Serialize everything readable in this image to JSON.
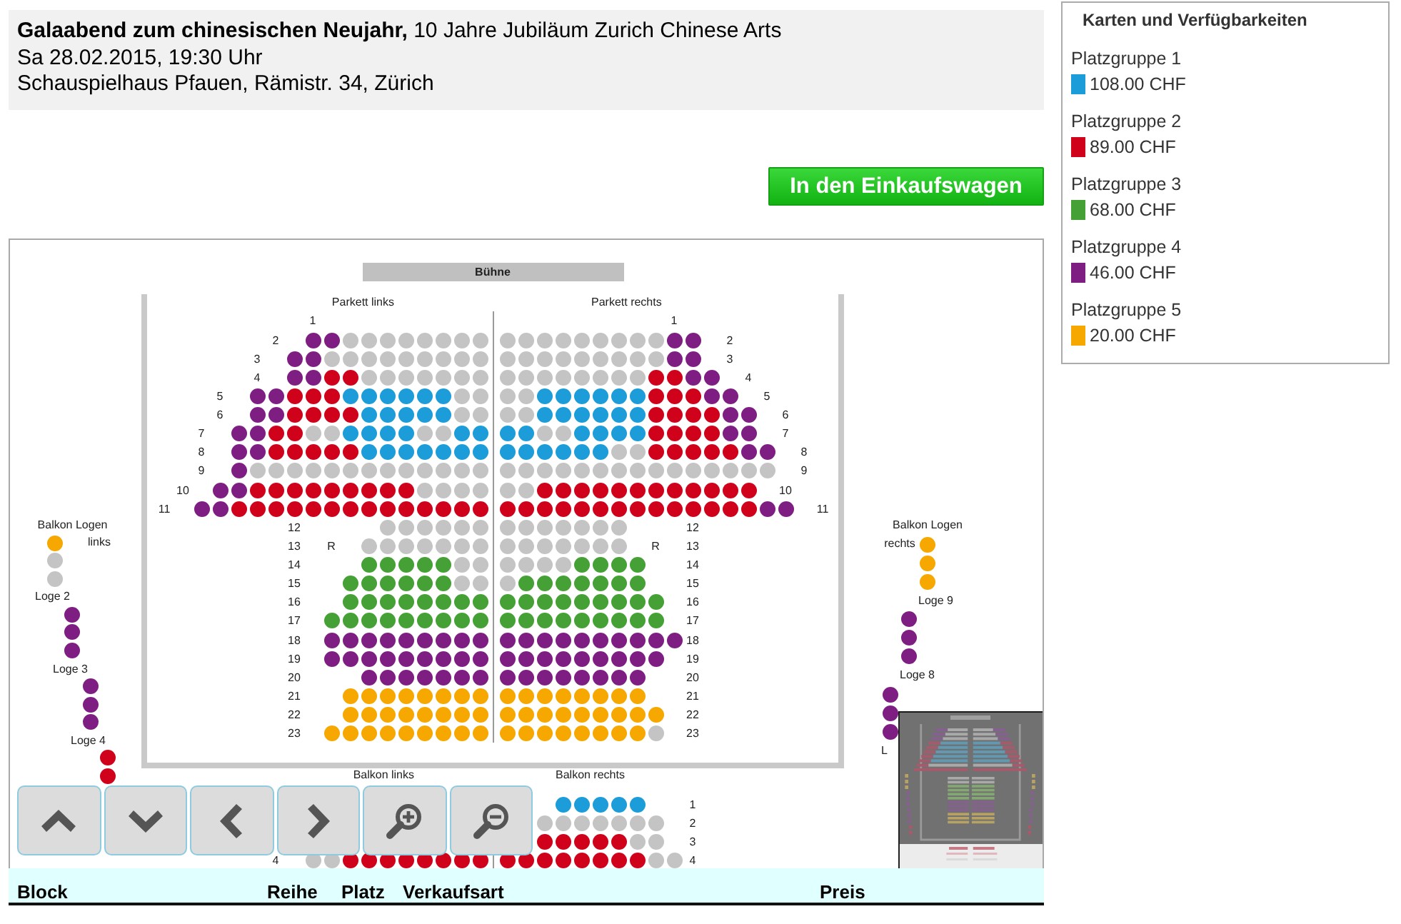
{
  "event": {
    "title": "**Galaabend zum chinesischen Neujahr,** 10 Jahre Jubiläum Zurich Chinese Arts",
    "date": "Sa 28.02.2015, 19:30 Uhr",
    "venue": "Schauspielhaus Pfauen, Rämistr. 34, Zürich"
  },
  "legend": {
    "title": "Karten und Verfügbarkeiten",
    "groups": [
      {
        "label": "Platzgruppe 1",
        "price": "108.00 CHF",
        "color": "#1c9cd8"
      },
      {
        "label": "Platzgruppe 2",
        "price": "89.00 CHF",
        "color": "#d0021b"
      },
      {
        "label": "Platzgruppe 3",
        "price": "68.00 CHF",
        "color": "#45a035"
      },
      {
        "label": "Platzgruppe 4",
        "price": "46.00 CHF",
        "color": "#7e1e82"
      },
      {
        "label": "Platzgruppe 5",
        "price": "20.00 CHF",
        "color": "#f6a800"
      }
    ]
  },
  "cart_button": "In den Einkaufswagen",
  "seat_map": {
    "stage": "Bühne",
    "parkett_links": {
      "title": "Parkett links",
      "front_rows": [
        {
          "label": "1"
        },
        {
          "label": "2",
          "seats": [
            {
              "color": "#7e1e82"
            },
            {
              "color": "#7e1e82"
            },
            {
              "color": "#c4c4c4"
            },
            {
              "color": "#c4c4c4"
            },
            {
              "color": "#c4c4c4"
            },
            {
              "color": "#c4c4c4"
            },
            {
              "color": "#c4c4c4"
            },
            {
              "color": "#c4c4c4"
            },
            {
              "color": "#c4c4c4"
            },
            {
              "color": "#c4c4c4"
            }
          ]
        },
        {
          "label": "3",
          "seats": [
            {
              "color": "#7e1e82"
            },
            {
              "color": "#7e1e82"
            },
            {
              "color": "#c4c4c4"
            },
            {
              "color": "#c4c4c4"
            },
            {
              "color": "#c4c4c4"
            },
            {
              "color": "#c4c4c4"
            },
            {
              "color": "#c4c4c4"
            },
            {
              "color": "#c4c4c4"
            },
            {
              "color": "#c4c4c4"
            },
            {
              "color": "#c4c4c4"
            },
            {
              "color": "#c4c4c4"
            }
          ]
        },
        {
          "label": "4",
          "seats": [
            {
              "color": "#7e1e82"
            },
            {
              "color": "#7e1e82"
            },
            {
              "color": "#d0021b"
            },
            {
              "color": "#d0021b"
            },
            {
              "color": "#c4c4c4"
            },
            {
              "color": "#c4c4c4"
            },
            {
              "color": "#c4c4c4"
            },
            {
              "color": "#c4c4c4"
            },
            {
              "color": "#c4c4c4"
            },
            {
              "color": "#c4c4c4"
            },
            {
              "color": "#c4c4c4"
            }
          ]
        },
        {
          "label": "5",
          "seats": [
            {
              "color": "#7e1e82"
            },
            {
              "color": "#7e1e82"
            },
            {
              "color": "#d0021b"
            },
            {
              "color": "#d0021b"
            },
            {
              "color": "#d0021b"
            },
            {
              "color": "#1c9cd8"
            },
            {
              "color": "#1c9cd8"
            },
            {
              "color": "#1c9cd8"
            },
            {
              "color": "#1c9cd8"
            },
            {
              "color": "#1c9cd8"
            },
            {
              "color": "#1c9cd8"
            },
            {
              "color": "#c4c4c4"
            },
            {
              "color": "#c4c4c4"
            }
          ]
        },
        {
          "label": "6",
          "seats": [
            {
              "color": "#7e1e82"
            },
            {
              "color": "#7e1e82"
            },
            {
              "color": "#d0021b"
            },
            {
              "color": "#d0021b"
            },
            {
              "color": "#d0021b"
            },
            {
              "color": "#d0021b"
            },
            {
              "color": "#1c9cd8"
            },
            {
              "color": "#1c9cd8"
            },
            {
              "color": "#1c9cd8"
            },
            {
              "color": "#1c9cd8"
            },
            {
              "color": "#1c9cd8"
            },
            {
              "color": "#c4c4c4"
            },
            {
              "color": "#c4c4c4"
            }
          ]
        },
        {
          "label": "7",
          "seats": [
            {
              "color": "#7e1e82"
            },
            {
              "color": "#7e1e82"
            },
            {
              "color": "#d0021b"
            },
            {
              "color": "#d0021b"
            },
            {
              "color": "#c4c4c4"
            },
            {
              "color": "#c4c4c4"
            },
            {
              "color": "#1c9cd8"
            },
            {
              "color": "#1c9cd8"
            },
            {
              "color": "#1c9cd8"
            },
            {
              "color": "#1c9cd8"
            },
            {
              "color": "#c4c4c4"
            },
            {
              "color": "#c4c4c4"
            },
            {
              "color": "#1c9cd8"
            },
            {
              "color": "#1c9cd8"
            }
          ]
        },
        {
          "label": "8",
          "seats": [
            {
              "color": "#7e1e82"
            },
            {
              "color": "#7e1e82"
            },
            {
              "color": "#d0021b"
            },
            {
              "color": "#d0021b"
            },
            {
              "color": "#d0021b"
            },
            {
              "color": "#d0021b"
            },
            {
              "color": "#d0021b"
            },
            {
              "color": "#1c9cd8"
            },
            {
              "color": "#1c9cd8"
            },
            {
              "color": "#1c9cd8"
            },
            {
              "color": "#1c9cd8"
            },
            {
              "color": "#1c9cd8"
            },
            {
              "color": "#1c9cd8"
            },
            {
              "color": "#1c9cd8"
            }
          ]
        },
        {
          "label": "9",
          "seats": [
            {
              "color": "#7e1e82"
            },
            {
              "color": "#c4c4c4"
            },
            {
              "color": "#c4c4c4"
            },
            {
              "color": "#c4c4c4"
            },
            {
              "color": "#c4c4c4"
            },
            {
              "color": "#c4c4c4"
            },
            {
              "color": "#c4c4c4"
            },
            {
              "color": "#c4c4c4"
            },
            {
              "color": "#c4c4c4"
            },
            {
              "color": "#c4c4c4"
            },
            {
              "color": "#c4c4c4"
            },
            {
              "color": "#c4c4c4"
            },
            {
              "color": "#c4c4c4"
            },
            {
              "color": "#c4c4c4"
            }
          ]
        },
        {
          "label": "10",
          "seats": [
            {
              "color": "#7e1e82"
            },
            {
              "color": "#7e1e82"
            },
            {
              "color": "#d0021b"
            },
            {
              "color": "#d0021b"
            },
            {
              "color": "#d0021b"
            },
            {
              "color": "#d0021b"
            },
            {
              "color": "#d0021b"
            },
            {
              "color": "#d0021b"
            },
            {
              "color": "#d0021b"
            },
            {
              "color": "#d0021b"
            },
            {
              "color": "#d0021b"
            },
            {
              "color": "#c4c4c4"
            },
            {
              "color": "#c4c4c4"
            },
            {
              "color": "#c4c4c4"
            },
            {
              "color": "#c4c4c4"
            }
          ]
        },
        {
          "label": "11",
          "seats": [
            {
              "color": "#7e1e82"
            },
            {
              "color": "#7e1e82"
            },
            {
              "color": "#d0021b"
            },
            {
              "color": "#d0021b"
            },
            {
              "color": "#d0021b"
            },
            {
              "color": "#d0021b"
            },
            {
              "color": "#d0021b"
            },
            {
              "color": "#d0021b"
            },
            {
              "color": "#d0021b"
            },
            {
              "color": "#d0021b"
            },
            {
              "color": "#d0021b"
            },
            {
              "color": "#d0021b"
            },
            {
              "color": "#d0021b"
            },
            {
              "color": "#d0021b"
            },
            {
              "color": "#d0021b"
            },
            {
              "color": "#d0021b"
            }
          ]
        }
      ],
      "rear_rows": [
        {
          "label": "12",
          "seats": [
            {
              "color": "#c4c4c4"
            },
            {
              "color": "#c4c4c4"
            },
            {
              "color": "#c4c4c4"
            },
            {
              "color": "#c4c4c4"
            },
            {
              "color": "#c4c4c4"
            },
            {
              "color": "#c4c4c4"
            }
          ]
        },
        {
          "label": "13",
          "marker": "R",
          "seats": [
            {
              "color": "#c4c4c4"
            },
            {
              "color": "#c4c4c4"
            },
            {
              "color": "#c4c4c4"
            },
            {
              "color": "#c4c4c4"
            },
            {
              "color": "#c4c4c4"
            },
            {
              "color": "#c4c4c4"
            },
            {
              "color": "#c4c4c4"
            }
          ]
        },
        {
          "label": "14",
          "seats": [
            {
              "color": "#45a035"
            },
            {
              "color": "#45a035"
            },
            {
              "color": "#45a035"
            },
            {
              "color": "#45a035"
            },
            {
              "color": "#45a035"
            },
            {
              "color": "#c4c4c4"
            },
            {
              "color": "#c4c4c4"
            }
          ]
        },
        {
          "label": "15",
          "seats": [
            {
              "color": "#45a035"
            },
            {
              "color": "#45a035"
            },
            {
              "color": "#45a035"
            },
            {
              "color": "#45a035"
            },
            {
              "color": "#45a035"
            },
            {
              "color": "#45a035"
            },
            {
              "color": "#c4c4c4"
            },
            {
              "color": "#c4c4c4"
            }
          ]
        },
        {
          "label": "16",
          "seats": [
            {
              "color": "#45a035"
            },
            {
              "color": "#45a035"
            },
            {
              "color": "#45a035"
            },
            {
              "color": "#45a035"
            },
            {
              "color": "#45a035"
            },
            {
              "color": "#45a035"
            },
            {
              "color": "#45a035"
            },
            {
              "color": "#45a035"
            }
          ]
        },
        {
          "label": "17",
          "seats": [
            {
              "color": "#45a035"
            },
            {
              "color": "#45a035"
            },
            {
              "color": "#45a035"
            },
            {
              "color": "#45a035"
            },
            {
              "color": "#45a035"
            },
            {
              "color": "#45a035"
            },
            {
              "color": "#45a035"
            },
            {
              "color": "#45a035"
            },
            {
              "color": "#45a035"
            }
          ]
        },
        {
          "label": "18",
          "seats": [
            {
              "color": "#7e1e82"
            },
            {
              "color": "#7e1e82"
            },
            {
              "color": "#7e1e82"
            },
            {
              "color": "#7e1e82"
            },
            {
              "color": "#7e1e82"
            },
            {
              "color": "#7e1e82"
            },
            {
              "color": "#7e1e82"
            },
            {
              "color": "#7e1e82"
            },
            {
              "color": "#7e1e82"
            }
          ]
        },
        {
          "label": "19",
          "seats": [
            {
              "color": "#7e1e82"
            },
            {
              "color": "#7e1e82"
            },
            {
              "color": "#7e1e82"
            },
            {
              "color": "#7e1e82"
            },
            {
              "color": "#7e1e82"
            },
            {
              "color": "#7e1e82"
            },
            {
              "color": "#7e1e82"
            },
            {
              "color": "#7e1e82"
            },
            {
              "color": "#7e1e82"
            }
          ]
        },
        {
          "label": "20",
          "seats": [
            {
              "color": "#7e1e82"
            },
            {
              "color": "#7e1e82"
            },
            {
              "color": "#7e1e82"
            },
            {
              "color": "#7e1e82"
            },
            {
              "color": "#7e1e82"
            },
            {
              "color": "#7e1e82"
            },
            {
              "color": "#7e1e82"
            }
          ]
        },
        {
          "label": "21",
          "seats": [
            {
              "color": "#f6a800"
            },
            {
              "color": "#f6a800"
            },
            {
              "color": "#f6a800"
            },
            {
              "color": "#f6a800"
            },
            {
              "color": "#f6a800"
            },
            {
              "color": "#f6a800"
            },
            {
              "color": "#f6a800"
            },
            {
              "color": "#f6a800"
            }
          ]
        },
        {
          "label": "22",
          "seats": [
            {
              "color": "#f6a800"
            },
            {
              "color": "#f6a800"
            },
            {
              "color": "#f6a800"
            },
            {
              "color": "#f6a800"
            },
            {
              "color": "#f6a800"
            },
            {
              "color": "#f6a800"
            },
            {
              "color": "#f6a800"
            },
            {
              "color": "#f6a800"
            }
          ]
        },
        {
          "label": "23",
          "seats": [
            {
              "color": "#f6a800"
            },
            {
              "color": "#f6a800"
            },
            {
              "color": "#f6a800"
            },
            {
              "color": "#f6a800"
            },
            {
              "color": "#f6a800"
            },
            {
              "color": "#f6a800"
            },
            {
              "color": "#f6a800"
            },
            {
              "color": "#f6a800"
            },
            {
              "color": "#f6a800"
            }
          ]
        }
      ]
    },
    "parkett_rechts": {
      "title": "Parkett rechts",
      "front_rows": [
        {
          "label": "1"
        },
        {
          "label": "2",
          "seats": [
            {
              "color": "#c4c4c4"
            },
            {
              "color": "#c4c4c4"
            },
            {
              "color": "#c4c4c4"
            },
            {
              "color": "#c4c4c4"
            },
            {
              "color": "#c4c4c4"
            },
            {
              "color": "#c4c4c4"
            },
            {
              "color": "#c4c4c4"
            },
            {
              "color": "#c4c4c4"
            },
            {
              "color": "#c4c4c4"
            },
            {
              "color": "#7e1e82"
            },
            {
              "color": "#7e1e82"
            }
          ]
        },
        {
          "label": "3",
          "seats": [
            {
              "color": "#c4c4c4"
            },
            {
              "color": "#c4c4c4"
            },
            {
              "color": "#c4c4c4"
            },
            {
              "color": "#c4c4c4"
            },
            {
              "color": "#c4c4c4"
            },
            {
              "color": "#c4c4c4"
            },
            {
              "color": "#c4c4c4"
            },
            {
              "color": "#c4c4c4"
            },
            {
              "color": "#c4c4c4"
            },
            {
              "color": "#7e1e82"
            },
            {
              "color": "#7e1e82"
            }
          ]
        },
        {
          "label": "4",
          "seats": [
            {
              "color": "#c4c4c4"
            },
            {
              "color": "#c4c4c4"
            },
            {
              "color": "#c4c4c4"
            },
            {
              "color": "#c4c4c4"
            },
            {
              "color": "#c4c4c4"
            },
            {
              "color": "#c4c4c4"
            },
            {
              "color": "#c4c4c4"
            },
            {
              "color": "#c4c4c4"
            },
            {
              "color": "#d0021b"
            },
            {
              "color": "#d0021b"
            },
            {
              "color": "#7e1e82"
            },
            {
              "color": "#7e1e82"
            }
          ]
        },
        {
          "label": "5",
          "seats": [
            {
              "color": "#c4c4c4"
            },
            {
              "color": "#c4c4c4"
            },
            {
              "color": "#1c9cd8"
            },
            {
              "color": "#1c9cd8"
            },
            {
              "color": "#1c9cd8"
            },
            {
              "color": "#1c9cd8"
            },
            {
              "color": "#1c9cd8"
            },
            {
              "color": "#1c9cd8"
            },
            {
              "color": "#d0021b"
            },
            {
              "color": "#d0021b"
            },
            {
              "color": "#d0021b"
            },
            {
              "color": "#7e1e82"
            },
            {
              "color": "#7e1e82"
            }
          ]
        },
        {
          "label": "6",
          "seats": [
            {
              "color": "#c4c4c4"
            },
            {
              "color": "#c4c4c4"
            },
            {
              "color": "#1c9cd8"
            },
            {
              "color": "#1c9cd8"
            },
            {
              "color": "#1c9cd8"
            },
            {
              "color": "#1c9cd8"
            },
            {
              "color": "#1c9cd8"
            },
            {
              "color": "#1c9cd8"
            },
            {
              "color": "#d0021b"
            },
            {
              "color": "#d0021b"
            },
            {
              "color": "#d0021b"
            },
            {
              "color": "#d0021b"
            },
            {
              "color": "#7e1e82"
            },
            {
              "color": "#7e1e82"
            }
          ]
        },
        {
          "label": "7",
          "seats": [
            {
              "color": "#1c9cd8"
            },
            {
              "color": "#1c9cd8"
            },
            {
              "color": "#c4c4c4"
            },
            {
              "color": "#c4c4c4"
            },
            {
              "color": "#1c9cd8"
            },
            {
              "color": "#1c9cd8"
            },
            {
              "color": "#1c9cd8"
            },
            {
              "color": "#1c9cd8"
            },
            {
              "color": "#d0021b"
            },
            {
              "color": "#d0021b"
            },
            {
              "color": "#d0021b"
            },
            {
              "color": "#d0021b"
            },
            {
              "color": "#7e1e82"
            },
            {
              "color": "#7e1e82"
            }
          ]
        },
        {
          "label": "8",
          "seats": [
            {
              "color": "#1c9cd8"
            },
            {
              "color": "#1c9cd8"
            },
            {
              "color": "#1c9cd8"
            },
            {
              "color": "#1c9cd8"
            },
            {
              "color": "#1c9cd8"
            },
            {
              "color": "#1c9cd8"
            },
            {
              "color": "#c4c4c4"
            },
            {
              "color": "#c4c4c4"
            },
            {
              "color": "#d0021b"
            },
            {
              "color": "#d0021b"
            },
            {
              "color": "#d0021b"
            },
            {
              "color": "#d0021b"
            },
            {
              "color": "#d0021b"
            },
            {
              "color": "#7e1e82"
            },
            {
              "color": "#7e1e82"
            }
          ]
        },
        {
          "label": "9",
          "seats": [
            {
              "color": "#c4c4c4"
            },
            {
              "color": "#c4c4c4"
            },
            {
              "color": "#c4c4c4"
            },
            {
              "color": "#c4c4c4"
            },
            {
              "color": "#c4c4c4"
            },
            {
              "color": "#c4c4c4"
            },
            {
              "color": "#c4c4c4"
            },
            {
              "color": "#c4c4c4"
            },
            {
              "color": "#c4c4c4"
            },
            {
              "color": "#c4c4c4"
            },
            {
              "color": "#c4c4c4"
            },
            {
              "color": "#c4c4c4"
            },
            {
              "color": "#c4c4c4"
            },
            {
              "color": "#c4c4c4"
            },
            {
              "color": "#c4c4c4"
            }
          ]
        },
        {
          "label": "10",
          "seats": [
            {
              "color": "#c4c4c4"
            },
            {
              "color": "#c4c4c4"
            },
            {
              "color": "#d0021b"
            },
            {
              "color": "#d0021b"
            },
            {
              "color": "#d0021b"
            },
            {
              "color": "#d0021b"
            },
            {
              "color": "#d0021b"
            },
            {
              "color": "#d0021b"
            },
            {
              "color": "#d0021b"
            },
            {
              "color": "#d0021b"
            },
            {
              "color": "#d0021b"
            },
            {
              "color": "#d0021b"
            },
            {
              "color": "#d0021b"
            },
            {
              "color": "#d0021b"
            }
          ]
        },
        {
          "label": "11",
          "seats": [
            {
              "color": "#d0021b"
            },
            {
              "color": "#d0021b"
            },
            {
              "color": "#d0021b"
            },
            {
              "color": "#d0021b"
            },
            {
              "color": "#d0021b"
            },
            {
              "color": "#d0021b"
            },
            {
              "color": "#d0021b"
            },
            {
              "color": "#d0021b"
            },
            {
              "color": "#d0021b"
            },
            {
              "color": "#d0021b"
            },
            {
              "color": "#d0021b"
            },
            {
              "color": "#d0021b"
            },
            {
              "color": "#d0021b"
            },
            {
              "color": "#d0021b"
            },
            {
              "color": "#7e1e82"
            },
            {
              "color": "#7e1e82"
            }
          ]
        }
      ],
      "rear_rows": [
        {
          "label": "12",
          "seats": [
            {
              "color": "#c4c4c4"
            },
            {
              "color": "#c4c4c4"
            },
            {
              "color": "#c4c4c4"
            },
            {
              "color": "#c4c4c4"
            },
            {
              "color": "#c4c4c4"
            },
            {
              "color": "#c4c4c4"
            },
            {
              "color": "#c4c4c4"
            }
          ]
        },
        {
          "label": "13",
          "marker": "R",
          "seats": [
            {
              "color": "#c4c4c4"
            },
            {
              "color": "#c4c4c4"
            },
            {
              "color": "#c4c4c4"
            },
            {
              "color": "#c4c4c4"
            },
            {
              "color": "#c4c4c4"
            },
            {
              "color": "#c4c4c4"
            },
            {
              "color": "#c4c4c4"
            }
          ]
        },
        {
          "label": "14",
          "seats": [
            {
              "color": "#c4c4c4"
            },
            {
              "color": "#c4c4c4"
            },
            {
              "color": "#c4c4c4"
            },
            {
              "color": "#c4c4c4"
            },
            {
              "color": "#45a035"
            },
            {
              "color": "#45a035"
            },
            {
              "color": "#45a035"
            },
            {
              "color": "#45a035"
            }
          ]
        },
        {
          "label": "15",
          "seats": [
            {
              "color": "#c4c4c4"
            },
            {
              "color": "#45a035"
            },
            {
              "color": "#45a035"
            },
            {
              "color": "#45a035"
            },
            {
              "color": "#45a035"
            },
            {
              "color": "#45a035"
            },
            {
              "color": "#45a035"
            },
            {
              "color": "#45a035"
            }
          ]
        },
        {
          "label": "16",
          "seats": [
            {
              "color": "#45a035"
            },
            {
              "color": "#45a035"
            },
            {
              "color": "#45a035"
            },
            {
              "color": "#45a035"
            },
            {
              "color": "#45a035"
            },
            {
              "color": "#45a035"
            },
            {
              "color": "#45a035"
            },
            {
              "color": "#45a035"
            },
            {
              "color": "#45a035"
            }
          ]
        },
        {
          "label": "17",
          "seats": [
            {
              "color": "#45a035"
            },
            {
              "color": "#45a035"
            },
            {
              "color": "#45a035"
            },
            {
              "color": "#45a035"
            },
            {
              "color": "#45a035"
            },
            {
              "color": "#45a035"
            },
            {
              "color": "#45a035"
            },
            {
              "color": "#45a035"
            },
            {
              "color": "#45a035"
            }
          ]
        },
        {
          "label": "18",
          "seats": [
            {
              "color": "#7e1e82"
            },
            {
              "color": "#7e1e82"
            },
            {
              "color": "#7e1e82"
            },
            {
              "color": "#7e1e82"
            },
            {
              "color": "#7e1e82"
            },
            {
              "color": "#7e1e82"
            },
            {
              "color": "#7e1e82"
            },
            {
              "color": "#7e1e82"
            },
            {
              "color": "#7e1e82"
            },
            {
              "color": "#7e1e82"
            }
          ]
        },
        {
          "label": "19",
          "seats": [
            {
              "color": "#7e1e82"
            },
            {
              "color": "#7e1e82"
            },
            {
              "color": "#7e1e82"
            },
            {
              "color": "#7e1e82"
            },
            {
              "color": "#7e1e82"
            },
            {
              "color": "#7e1e82"
            },
            {
              "color": "#7e1e82"
            },
            {
              "color": "#7e1e82"
            },
            {
              "color": "#7e1e82"
            }
          ]
        },
        {
          "label": "20",
          "seats": [
            {
              "color": "#7e1e82"
            },
            {
              "color": "#7e1e82"
            },
            {
              "color": "#7e1e82"
            },
            {
              "color": "#7e1e82"
            },
            {
              "color": "#7e1e82"
            },
            {
              "color": "#7e1e82"
            },
            {
              "color": "#7e1e82"
            },
            {
              "color": "#7e1e82"
            }
          ]
        },
        {
          "label": "21",
          "seats": [
            {
              "color": "#f6a800"
            },
            {
              "color": "#f6a800"
            },
            {
              "color": "#f6a800"
            },
            {
              "color": "#f6a800"
            },
            {
              "color": "#f6a800"
            },
            {
              "color": "#f6a800"
            },
            {
              "color": "#f6a800"
            },
            {
              "color": "#f6a800"
            }
          ]
        },
        {
          "label": "22",
          "seats": [
            {
              "color": "#f6a800"
            },
            {
              "color": "#f6a800"
            },
            {
              "color": "#f6a800"
            },
            {
              "color": "#f6a800"
            },
            {
              "color": "#f6a800"
            },
            {
              "color": "#f6a800"
            },
            {
              "color": "#f6a800"
            },
            {
              "color": "#f6a800"
            },
            {
              "color": "#f6a800"
            }
          ]
        },
        {
          "label": "23",
          "seats": [
            {
              "color": "#f6a800"
            },
            {
              "color": "#f6a800"
            },
            {
              "color": "#f6a800"
            },
            {
              "color": "#f6a800"
            },
            {
              "color": "#f6a800"
            },
            {
              "color": "#f6a800"
            },
            {
              "color": "#f6a800"
            },
            {
              "color": "#f6a800"
            },
            {
              "color": "#c4c4c4"
            }
          ]
        }
      ]
    },
    "logen_links": {
      "title": "Balkon Logen",
      "subtitle": "links",
      "boxes": [
        {
          "seats": [
            {
              "color": "#f6a800"
            },
            {
              "color": "#c4c4c4"
            },
            {
              "color": "#c4c4c4"
            }
          ]
        },
        {
          "label": "Loge 2",
          "seats": [
            {
              "color": "#7e1e82"
            },
            {
              "color": "#7e1e82"
            },
            {
              "color": "#7e1e82"
            }
          ]
        },
        {
          "label": "Loge 3",
          "seats": [
            {
              "color": "#7e1e82"
            },
            {
              "color": "#7e1e82"
            },
            {
              "color": "#7e1e82"
            }
          ]
        },
        {
          "label": "Loge 4",
          "seats": [
            {
              "color": "#d0021b"
            },
            {
              "color": "#d0021b"
            }
          ]
        }
      ]
    },
    "logen_rechts": {
      "title": "Balkon Logen",
      "subtitle": "rechts",
      "boxes": [
        {
          "seats": [
            {
              "color": "#f6a800"
            },
            {
              "color": "#f6a800"
            },
            {
              "color": "#f6a800"
            }
          ]
        },
        {
          "label": "Loge 9",
          "seats": [
            {
              "color": "#7e1e82"
            },
            {
              "color": "#7e1e82"
            },
            {
              "color": "#7e1e82"
            }
          ]
        },
        {
          "label": "Loge 8",
          "seats": [
            {
              "color": "#7e1e82"
            },
            {
              "color": "#7e1e82"
            },
            {
              "color": "#7e1e82"
            }
          ]
        },
        {
          "label": "L"
        }
      ]
    },
    "balkon_links": {
      "title": "Balkon links",
      "rows": [
        {
          "label": "4",
          "seats": [
            {
              "color": "#c4c4c4"
            },
            {
              "color": "#c4c4c4"
            },
            {
              "color": "#d0021b"
            },
            {
              "color": "#d0021b"
            },
            {
              "color": "#d0021b"
            },
            {
              "color": "#d0021b"
            },
            {
              "color": "#d0021b"
            },
            {
              "color": "#d0021b"
            },
            {
              "color": "#d0021b"
            },
            {
              "color": "#d0021b"
            }
          ]
        }
      ]
    },
    "balkon_rechts": {
      "title": "Balkon rechts",
      "rows": [
        {
          "label": "1",
          "seats": [
            {
              "color": "#1c9cd8"
            },
            {
              "color": "#1c9cd8"
            },
            {
              "color": "#1c9cd8"
            },
            {
              "color": "#1c9cd8"
            },
            {
              "color": "#1c9cd8"
            }
          ]
        },
        {
          "label": "2",
          "seats": [
            {
              "color": "#c4c4c4"
            },
            {
              "color": "#c4c4c4"
            },
            {
              "color": "#c4c4c4"
            },
            {
              "color": "#c4c4c4"
            },
            {
              "color": "#c4c4c4"
            },
            {
              "color": "#c4c4c4"
            },
            {
              "color": "#c4c4c4"
            }
          ]
        },
        {
          "label": "3",
          "seats": [
            {
              "color": "#d0021b"
            },
            {
              "color": "#d0021b"
            },
            {
              "color": "#d0021b"
            },
            {
              "color": "#d0021b"
            },
            {
              "color": "#d0021b"
            },
            {
              "color": "#c4c4c4"
            },
            {
              "color": "#c4c4c4"
            }
          ]
        },
        {
          "label": "4",
          "seats": [
            {
              "color": "#d0021b"
            },
            {
              "color": "#d0021b"
            },
            {
              "color": "#d0021b"
            },
            {
              "color": "#d0021b"
            },
            {
              "color": "#d0021b"
            },
            {
              "color": "#d0021b"
            },
            {
              "color": "#d0021b"
            },
            {
              "color": "#d0021b"
            },
            {
              "color": "#c4c4c4"
            },
            {
              "color": "#c4c4c4"
            }
          ]
        }
      ]
    }
  },
  "table": {
    "columns": [
      "Block",
      "Reihe",
      "Platz",
      "Verkaufsart",
      "Preis"
    ]
  }
}
